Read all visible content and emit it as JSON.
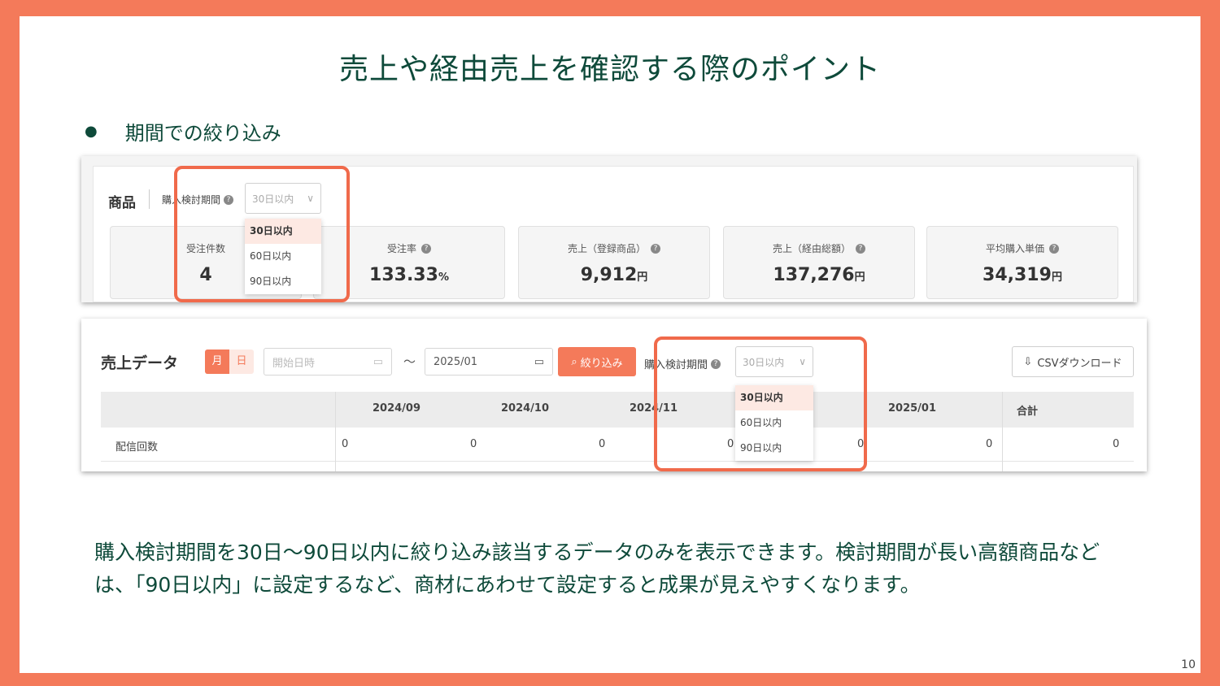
{
  "slide": {
    "title": "売上や経由売上を確認する際のポイント",
    "bullet": "期間での絞り込み",
    "description": "購入検討期間を30日〜90日以内に絞り込み該当するデータのみを表示できます。検討期間が長い高額商品などは、「90日以内」に設定するなど、商材にあわせて設定すると成果が見えやすくなります。",
    "page_number": "10"
  },
  "product_panel": {
    "label": "商品",
    "period_label": "購入検討期間",
    "period_value": "30日以内",
    "period_options": [
      "30日以内",
      "60日以内",
      "90日以内"
    ],
    "cards": [
      {
        "label": "受注件数",
        "value": "4",
        "unit": ""
      },
      {
        "label": "受注率",
        "value": "133.33",
        "unit": "%"
      },
      {
        "label": "売上（登録商品）",
        "value": "9,912",
        "unit": "円"
      },
      {
        "label": "売上（経由総額）",
        "value": "137,276",
        "unit": "円"
      },
      {
        "label": "平均購入単価",
        "value": "34,319",
        "unit": "円"
      }
    ]
  },
  "sales_panel": {
    "title": "売上データ",
    "toggle_month": "月",
    "toggle_day": "日",
    "start_placeholder": "開始日時",
    "end_value": "2025/01",
    "tilde": "〜",
    "filter_button": "絞り込み",
    "period_label": "購入検討期間",
    "period_value": "30日以内",
    "period_options": [
      "30日以内",
      "60日以内",
      "90日以内"
    ],
    "csv_button": "CSVダウンロード",
    "columns": [
      "2024/09",
      "2024/10",
      "2024/11",
      "2025/01",
      "合計"
    ],
    "row": {
      "label": "配信回数",
      "values": [
        "0",
        "0",
        "0",
        "0",
        "0",
        "0",
        "0"
      ]
    }
  },
  "colors": {
    "accent": "#f47a5a",
    "title": "#0e4a3a",
    "highlight": "#f06a4b"
  }
}
